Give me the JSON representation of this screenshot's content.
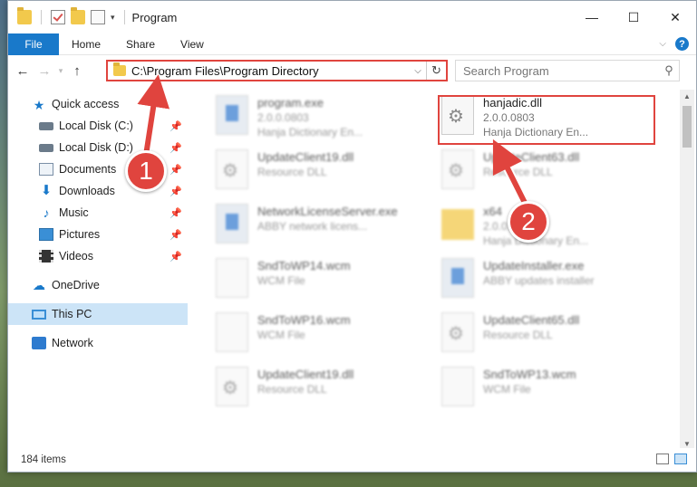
{
  "window": {
    "title": "Program",
    "controls": {
      "minimize": "—",
      "maximize": "☐",
      "close": "✕"
    }
  },
  "ribbon": {
    "tabs": [
      {
        "label": "File"
      },
      {
        "label": "Home"
      },
      {
        "label": "Share"
      },
      {
        "label": "View"
      }
    ]
  },
  "address": {
    "path": "C:\\Program Files\\Program Directory"
  },
  "search": {
    "placeholder": "Search Program"
  },
  "sidebar": {
    "items": [
      {
        "label": "Quick access",
        "icon": "star-icon"
      },
      {
        "label": "Local Disk (C:)",
        "icon": "drive-icon"
      },
      {
        "label": "Local Disk (D:)",
        "icon": "drive-icon"
      },
      {
        "label": "Documents",
        "icon": "documents-icon"
      },
      {
        "label": "Downloads",
        "icon": "download-icon"
      },
      {
        "label": "Music",
        "icon": "music-icon"
      },
      {
        "label": "Pictures",
        "icon": "pictures-icon"
      },
      {
        "label": "Videos",
        "icon": "videos-icon"
      },
      {
        "label": "OneDrive",
        "icon": "cloud-icon"
      },
      {
        "label": "This PC",
        "icon": "computer-icon"
      },
      {
        "label": "Network",
        "icon": "network-icon"
      }
    ]
  },
  "files": [
    {
      "name": "program.exe",
      "line2": "2.0.0.0803",
      "line3": "Hanja Dictionary En...",
      "icon": "app-icon"
    },
    {
      "name": "hanjadic.dll",
      "line2": "2.0.0.0803",
      "line3": "Hanja Dictionary En...",
      "icon": "gear-file-icon"
    },
    {
      "name": "UpdateClient19.dll",
      "line2": "Resource DLL",
      "line3": "",
      "icon": "gear-file-icon"
    },
    {
      "name": "UpdateClient63.dll",
      "line2": "Resource DLL",
      "line3": "",
      "icon": "gear-file-icon"
    },
    {
      "name": "NetworkLicenseServer.exe",
      "line2": "ABBY network licens...",
      "line3": "",
      "icon": "app-icon"
    },
    {
      "name": "x64",
      "line2": "2.0.0.0803",
      "line3": "Hanja Dictionary En...",
      "icon": "folder-icon"
    },
    {
      "name": "SndToWP14.wcm",
      "line2": "WCM File",
      "line3": "",
      "icon": "blank-file-icon"
    },
    {
      "name": "UpdateInstaller.exe",
      "line2": "ABBY updates installer",
      "line3": "",
      "icon": "app-icon"
    },
    {
      "name": "SndToWP16.wcm",
      "line2": "WCM File",
      "line3": "",
      "icon": "blank-file-icon"
    },
    {
      "name": "UpdateClient65.dll",
      "line2": "Resource DLL",
      "line3": "",
      "icon": "gear-file-icon"
    },
    {
      "name": "UpdateClient19.dll",
      "line2": "Resource DLL",
      "line3": "",
      "icon": "gear-file-icon"
    },
    {
      "name": "SndToWP13.wcm",
      "line2": "WCM File",
      "line3": "",
      "icon": "blank-file-icon"
    }
  ],
  "status": {
    "count": "184 items"
  },
  "annotations": {
    "step1": "1",
    "step2": "2",
    "color": "#e0443e"
  }
}
